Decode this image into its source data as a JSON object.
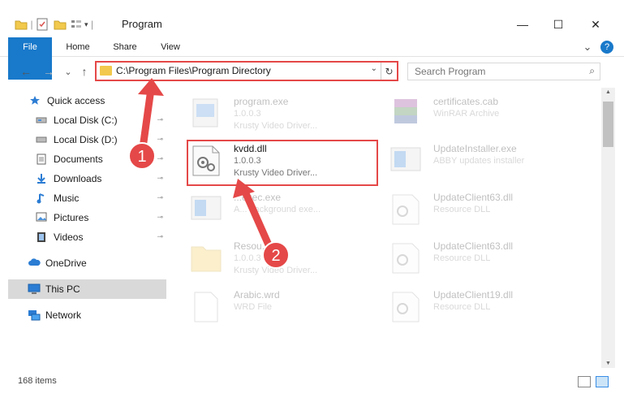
{
  "window": {
    "title": "Program",
    "minimize_glyph": "—",
    "maximize_glyph": "☐",
    "close_glyph": "✕"
  },
  "ribbon": {
    "tabs": [
      {
        "label": "File"
      },
      {
        "label": "Home"
      },
      {
        "label": "Share"
      },
      {
        "label": "View"
      }
    ],
    "help_glyph": "?",
    "expand_glyph": "⌄"
  },
  "nav": {
    "back": "←",
    "forward": "→",
    "recent": "⌄",
    "up": "↑"
  },
  "address": {
    "path": "C:\\Program Files\\Program Directory",
    "dropdown": "⌄",
    "refresh": "↻"
  },
  "search": {
    "placeholder": "Search Program",
    "icon": "⌕"
  },
  "sidebar": {
    "items": [
      {
        "label": "Quick access",
        "icon": "star-icon"
      },
      {
        "label": "Local Disk (C:)",
        "icon": "disk-icon"
      },
      {
        "label": "Local Disk (D:)",
        "icon": "disk-icon"
      },
      {
        "label": "Documents",
        "icon": "documents-icon"
      },
      {
        "label": "Downloads",
        "icon": "downloads-icon"
      },
      {
        "label": "Music",
        "icon": "music-icon"
      },
      {
        "label": "Pictures",
        "icon": "pictures-icon"
      },
      {
        "label": "Videos",
        "icon": "videos-icon"
      },
      {
        "label": "OneDrive",
        "icon": "cloud-icon"
      },
      {
        "label": "This PC",
        "icon": "computer-icon"
      },
      {
        "label": "Network",
        "icon": "network-icon"
      }
    ],
    "pin_glyph": "📌"
  },
  "files": {
    "left": [
      {
        "name": "program.exe",
        "line1": "1.0.0.3",
        "line2": "Krusty Video Driver..."
      },
      {
        "name": "kvdd.dll",
        "line1": "1.0.0.3",
        "line2": "Krusty Video Driver..."
      },
      {
        "name": "...exec.exe",
        "line1": "A... background exe...",
        "line2": ""
      },
      {
        "name": "Resou...",
        "line1": "1.0.0.3",
        "line2": "Krusty Video Driver..."
      },
      {
        "name": "Arabic.wrd",
        "line1": "WRD File",
        "line2": ""
      }
    ],
    "right": [
      {
        "name": "certificates.cab",
        "line1": "WinRAR Archive",
        "line2": ""
      },
      {
        "name": "UpdateInstaller.exe",
        "line1": "ABBY updates installer",
        "line2": ""
      },
      {
        "name": "UpdateClient63.dll",
        "line1": "Resource DLL",
        "line2": ""
      },
      {
        "name": "UpdateClient63.dll",
        "line1": "Resource DLL",
        "line2": ""
      },
      {
        "name": "UpdateClient19.dll",
        "line1": "Resource DLL",
        "line2": ""
      }
    ]
  },
  "annotations": {
    "step1": "1",
    "step2": "2",
    "color": "#e54848"
  },
  "status": {
    "count": "168 items"
  }
}
